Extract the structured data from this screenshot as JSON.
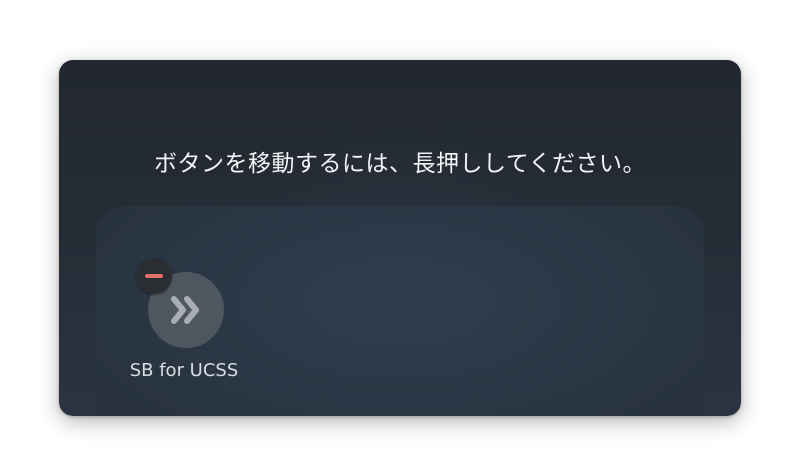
{
  "instruction": {
    "text": "ボタンを移動するには、長押ししてください。"
  },
  "apps": [
    {
      "label": "SB for UCSS",
      "icon": "double-chevron-right-icon",
      "badge": "remove-icon"
    }
  ],
  "colors": {
    "remove_badge": "#e07068",
    "icon_bg": "#4e5660",
    "panel_bg": "#232932"
  }
}
